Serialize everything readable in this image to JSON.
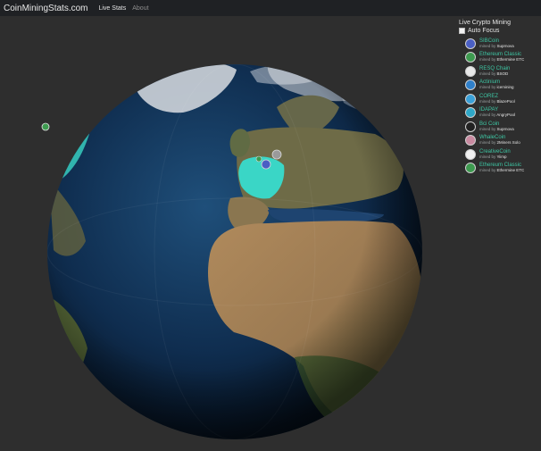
{
  "navbar": {
    "brand": "CoinMiningStats.com",
    "links": [
      {
        "label": "Live Stats"
      },
      {
        "label": "About"
      }
    ]
  },
  "panel": {
    "title": "Live Crypto Mining",
    "auto_focus_label": "Auto Focus",
    "auto_focus_checked": false,
    "mined_by_prefix": "mined by",
    "coins": [
      {
        "name": "SIBCoin",
        "pool": "Suprnova",
        "icon": "sibcoin-icon",
        "color": "#4a5fc4"
      },
      {
        "name": "Ethereum Classic",
        "pool": "Ethermine ETC",
        "icon": "ethereum-classic-icon",
        "color": "#3d9a4f"
      },
      {
        "name": "RESQ Chain",
        "pool": "BSOD",
        "icon": "resq-chain-icon",
        "color": "#e8e8e8"
      },
      {
        "name": "Actinium",
        "pool": "icemining",
        "icon": "actinium-icon",
        "color": "#2f7fc9"
      },
      {
        "name": "COREZ",
        "pool": "BlazePool",
        "icon": "corez-icon",
        "color": "#3aa0d8"
      },
      {
        "name": "IDAPAY",
        "pool": "AngryPool",
        "icon": "idapay-icon",
        "color": "#2fa8c8"
      },
      {
        "name": "Bci Coin",
        "pool": "Suprnova",
        "icon": "bci-coin-icon",
        "color": "#222222"
      },
      {
        "name": "WhaleCoin",
        "pool": "2Miners Solo",
        "icon": "whalecoin-icon",
        "color": "#c98aa0"
      },
      {
        "name": "CreativeCoin",
        "pool": "Yiimp",
        "icon": "creativecoin-icon",
        "color": "#f0f0f0"
      },
      {
        "name": "Ethereum Classic",
        "pool": "Ethermine ETC",
        "icon": "ethereum-classic-icon",
        "color": "#3d9a4f"
      }
    ]
  },
  "globe": {
    "highlight_color": "#3ad6c6",
    "ocean_color": "#0d2744",
    "land_color": "#8f7656"
  }
}
